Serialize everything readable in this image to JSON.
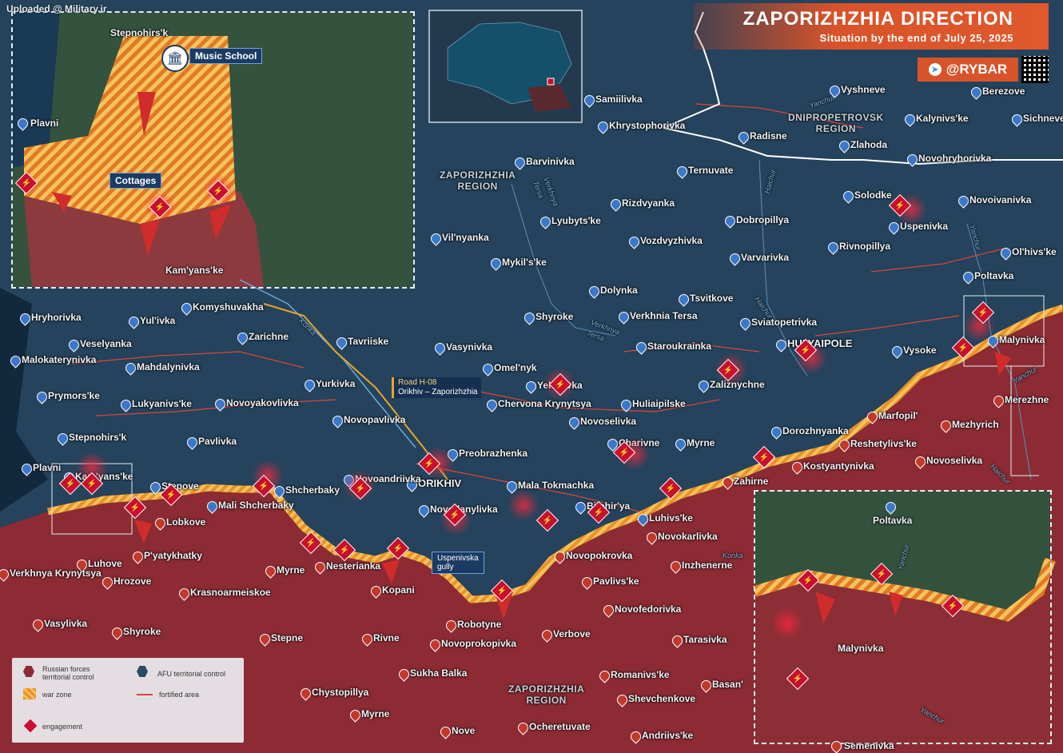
{
  "watermark": "Uploaded @ Military.ir",
  "header": {
    "title": "ZAPORIZHZHIA DIRECTION",
    "subtitle": "Situation by the end of July 25, 2025",
    "brand": "@RYBAR"
  },
  "colors": {
    "afu_territory": "#2a4a66",
    "russian_territory": "#8e2a33",
    "war_zone": "#f0a030",
    "engagement": "#c8102e",
    "header": "#d9532a"
  },
  "regions": {
    "dnipropetrovsk": "DNIPROPETROVSK\nREGION",
    "zaporizhzhia_north": "ZAPORIZHZHIA\nREGION",
    "zaporizhzhia_south": "ZAPORIZHZHIA\nREGION"
  },
  "rivers": {
    "konka_west": "Konka",
    "konka_east": "Konka",
    "verkhnya_tersa": "Verkhnya\nTersa",
    "verkhnya_tersa_2": "Verkhnya\nTersa",
    "yanchur_1": "Yanchur",
    "yanchur_2": "Yanchur",
    "yanchur_3": "Yanchur",
    "haichur_1": "Haichur",
    "haichur_2": "Haichur",
    "haichur_3": "Haichur"
  },
  "road": {
    "label_1": "Road H-08",
    "label_2": "Orikhiv – Zaporizhzhia"
  },
  "gully": {
    "label": "Uspenivska\ngully"
  },
  "inset_left": {
    "stepnohirsk": "Stepnohirs'k",
    "plavni": "Plavni",
    "kamyanske": "Kam'yans'ke",
    "music_school": "Music School",
    "cottages": "Cottages"
  },
  "inset_right": {
    "poltavka": "Poltavka",
    "malynivka": "Malynivka",
    "yanchur": "Yanchur",
    "yanchur_2": "Yanchur",
    "semenivka": "Semenivka"
  },
  "afu_towns": [
    "Samiilivka",
    "Khrystophorivka",
    "Barvinivka",
    "Ternuvate",
    "Radisne",
    "Vyshneve",
    "Berezove",
    "Kalynivs'ke",
    "Sichneve",
    "Zlahoda",
    "Novohryhorivka",
    "Solodke",
    "Novoivanivka",
    "Uspenivka",
    "Rizdvyanka",
    "Dobropillya",
    "Lyubyts'ke",
    "Vil'nyanka",
    "Vozdvyzhivka",
    "Rivnopillya",
    "Ol'hivs'ke",
    "Mykil's'ke",
    "Varvarivka",
    "Poltavka",
    "Dolynka",
    "Tsvitkove",
    "Shyroke",
    "Verkhnia Tersa",
    "Sviatopetrivka",
    "Staroukrainka",
    "HULYAIPOLE",
    "Vysoke",
    "Malynivka",
    "Komyshuvakha",
    "Hryhorivka",
    "Yul'ivka",
    "Zarichne",
    "Veselyanka",
    "Tavriiske",
    "Vasynivka",
    "Malokaterynivka",
    "Mahdalynivka",
    "Omel'nyk",
    "Yehorivka",
    "Zaliznychne",
    "Yurkivka",
    "Prymors'ke",
    "Lukyanivs'ke",
    "Novoyakovlivka",
    "Chervona Krynytsya",
    "Huliaipilske",
    "Novoselivka",
    "Novopavlivka",
    "Stepnohirs'k",
    "Pavlivka",
    "Charivne",
    "Myrne",
    "Dorozhnyanka",
    "Preobrazhenka",
    "ORIKHIV",
    "Plavni",
    "Kam'yans'ke",
    "Novoandriivka",
    "Stepove",
    "Shcherbaky",
    "Mali Shcherbaky",
    "Mala Tokmachka",
    "Novodanylivka",
    "Bilohir'ya",
    "Luhivs'ke"
  ],
  "ru_towns": [
    "Marfopil'",
    "Mezhyrich",
    "Reshetylivs'ke",
    "Kostyantynivka",
    "Zahirne",
    "Novoselivka",
    "Merezhne",
    "Lobkove",
    "P'yatykhatky",
    "Luhove",
    "Hrozove",
    "Verkhnya Krynytsya",
    "Krasnoarmeiskoe",
    "Myrne",
    "Nesterianka",
    "Kopani",
    "Novokarlivka",
    "Novopokrovka",
    "Inzhenerne",
    "Pavlivs'ke",
    "Vasylivka",
    "Shyroke",
    "Stepne",
    "Rivne",
    "Robotyne",
    "Novoprokopivka",
    "Verbove",
    "Novofedorivka",
    "Tarasivka",
    "Sukha Balka",
    "Romanivs'ke",
    "Basan'",
    "Chystopillya",
    "Shevchenkove",
    "Myrne",
    "Nove",
    "Ocheretuvate",
    "Andriivs'ke"
  ],
  "legend": {
    "ru_control": "Russian forces\nterritorial control",
    "afu_control": "AFU territorial control",
    "war_zone": "war zone",
    "fortified_area": "fortified area",
    "engagement": "engagement"
  }
}
